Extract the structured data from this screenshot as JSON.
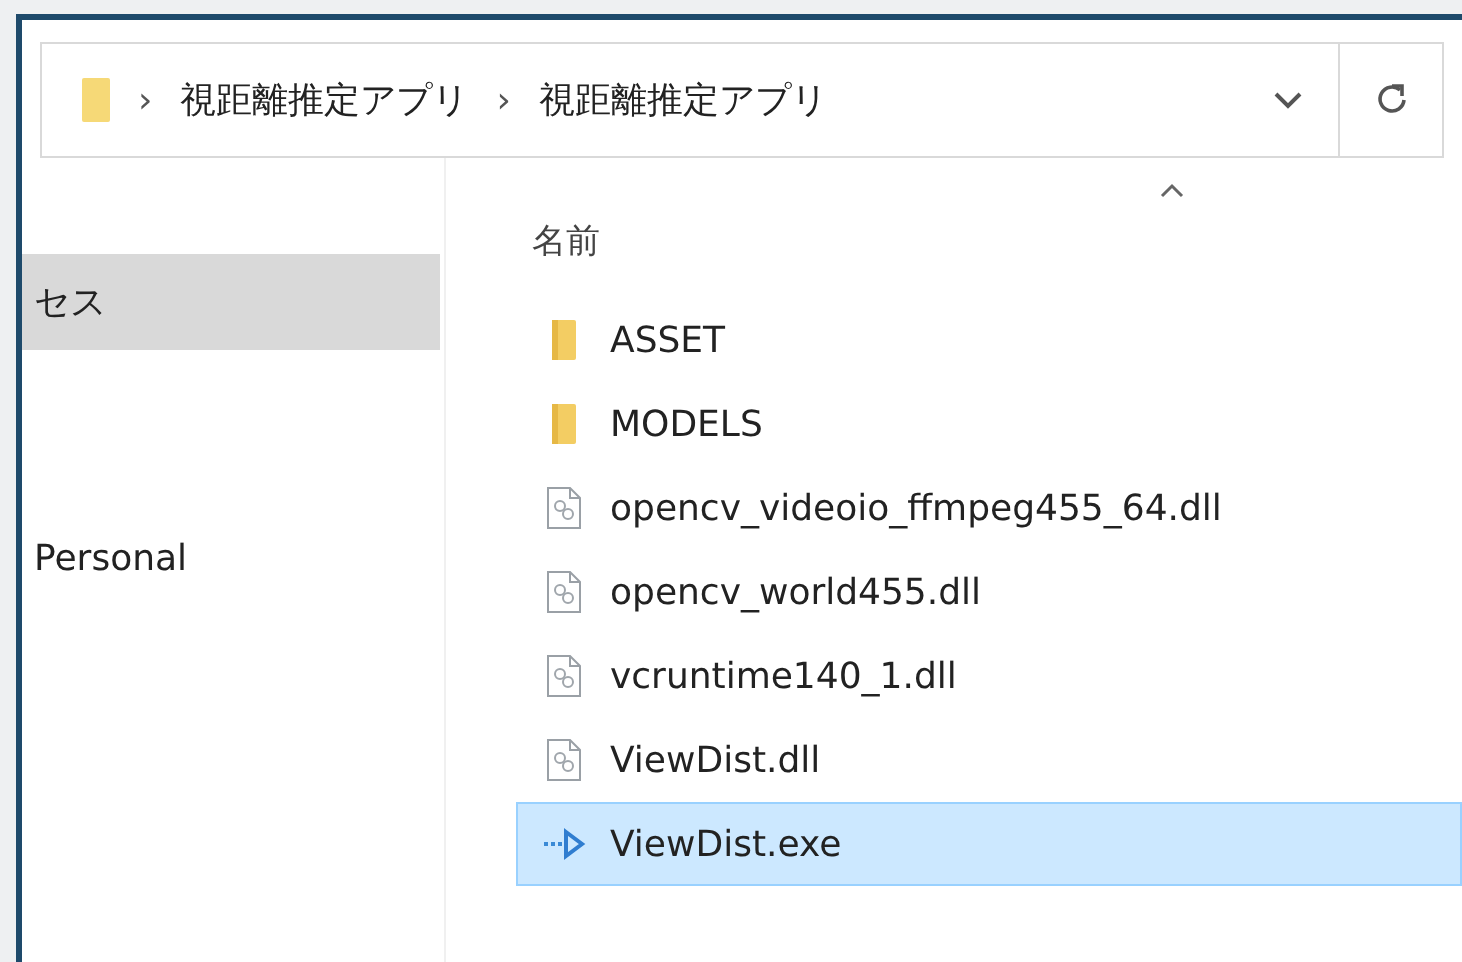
{
  "address_bar": {
    "path": [
      "視距離推定アプリ",
      "視距離推定アプリ"
    ],
    "separator": "›"
  },
  "nav": [
    {
      "label": "セス",
      "selected": true
    },
    {
      "label": "Personal",
      "selected": false
    }
  ],
  "column_header": {
    "label": "名前",
    "sorted": true
  },
  "files": [
    {
      "name": "ASSET",
      "kind": "folder",
      "selected": false
    },
    {
      "name": "MODELS",
      "kind": "folder",
      "selected": false
    },
    {
      "name": "opencv_videoio_ffmpeg455_64.dll",
      "kind": "dll",
      "selected": false
    },
    {
      "name": "opencv_world455.dll",
      "kind": "dll",
      "selected": false
    },
    {
      "name": "vcruntime140_1.dll",
      "kind": "dll",
      "selected": false
    },
    {
      "name": "ViewDist.dll",
      "kind": "dll",
      "selected": false
    },
    {
      "name": "ViewDist.exe",
      "kind": "exe",
      "selected": true
    }
  ]
}
